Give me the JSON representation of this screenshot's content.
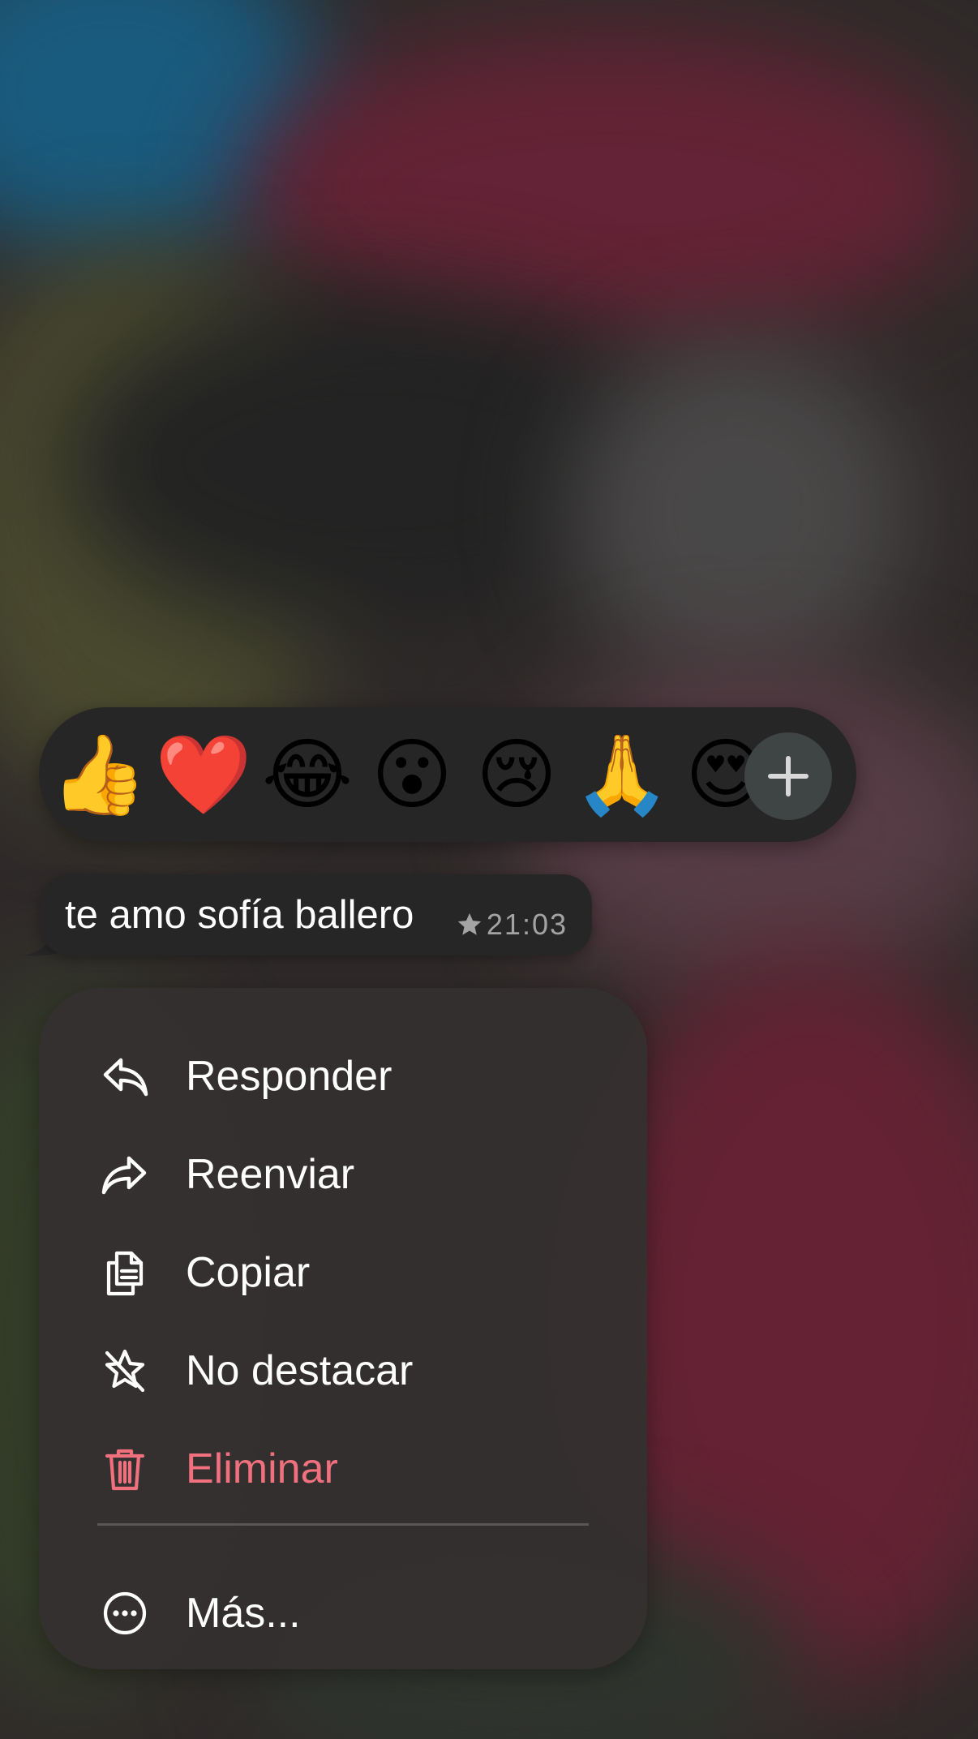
{
  "reactions": {
    "emojis": [
      "👍",
      "❤️",
      "😂",
      "😮",
      "😢",
      "🙏",
      "😍"
    ],
    "more_icon": "plus-icon"
  },
  "message": {
    "text": "te amo sofía ballero",
    "starred_icon": "star-icon",
    "time": "21:03"
  },
  "menu": {
    "items": [
      {
        "label": "Responder",
        "icon": "reply-icon"
      },
      {
        "label": "Reenviar",
        "icon": "forward-icon"
      },
      {
        "label": "Copiar",
        "icon": "copy-icon"
      },
      {
        "label": "No destacar",
        "icon": "unstar-icon"
      },
      {
        "label": "Eliminar",
        "icon": "trash-icon",
        "color": "#f0707e"
      },
      {
        "label": "Más...",
        "icon": "more-icon"
      }
    ]
  },
  "colors": {
    "danger": "#f0707e",
    "surface": "#262626"
  }
}
